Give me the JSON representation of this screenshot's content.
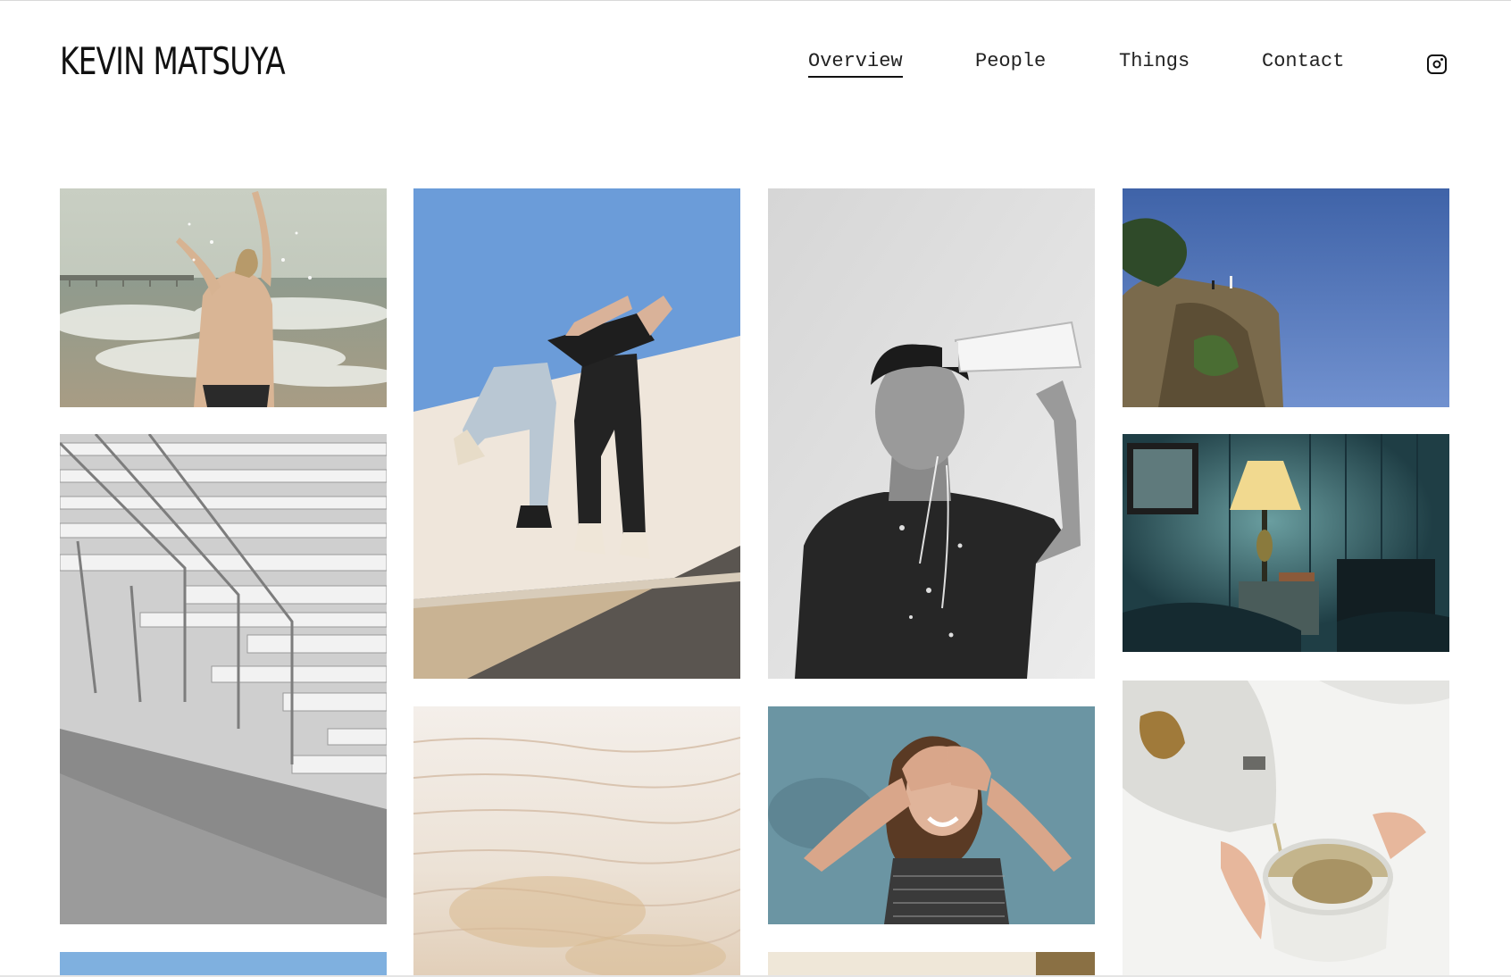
{
  "site": {
    "title": "KEVIN MATSUYA"
  },
  "nav": {
    "items": [
      {
        "label": "Overview",
        "active": true
      },
      {
        "label": "People",
        "active": false
      },
      {
        "label": "Things",
        "active": false
      },
      {
        "label": "Contact",
        "active": false
      }
    ],
    "social_icon": "instagram-icon"
  },
  "gallery": {
    "photos": [
      {
        "name": "photo-beach-splash",
        "description_icon": "image"
      },
      {
        "name": "photo-bleachers",
        "description_icon": "image"
      },
      {
        "name": "photo-sky-partial",
        "description_icon": "image"
      },
      {
        "name": "photo-wall-climb",
        "description_icon": "image"
      },
      {
        "name": "photo-travertine",
        "description_icon": "image"
      },
      {
        "name": "photo-water-bottle-portrait",
        "description_icon": "image"
      },
      {
        "name": "photo-laughing-woman",
        "description_icon": "image"
      },
      {
        "name": "photo-partial-bottom",
        "description_icon": "image"
      },
      {
        "name": "photo-cliff",
        "description_icon": "image"
      },
      {
        "name": "photo-lamp-room",
        "description_icon": "image"
      },
      {
        "name": "photo-pouring-tea",
        "description_icon": "image"
      }
    ]
  },
  "colors": {
    "text": "#111111",
    "background": "#ffffff"
  }
}
